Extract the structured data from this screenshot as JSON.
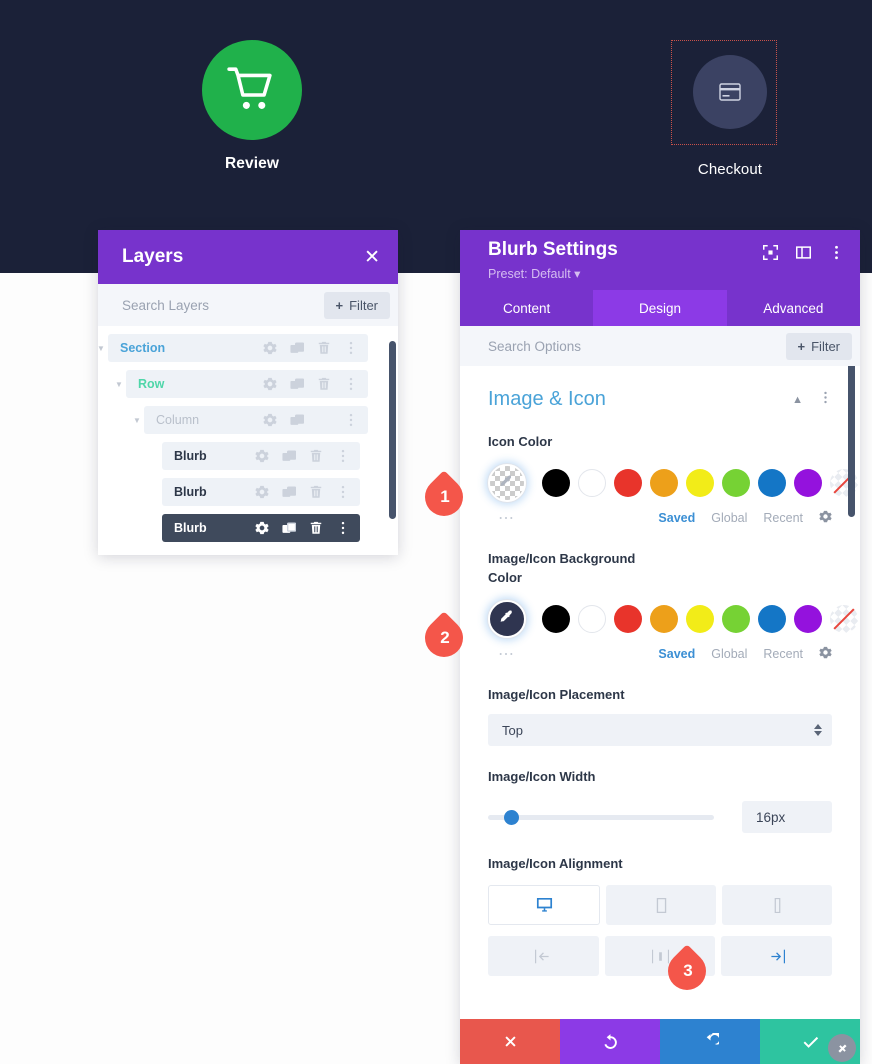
{
  "hero": {
    "items": [
      {
        "label": "Review",
        "icon": "shopping-cart-icon",
        "circle_color": "#20b14b",
        "selected": false
      },
      {
        "label": "Checkout",
        "icon": "credit-card-icon",
        "circle_color": "#3b4263",
        "selected": true
      }
    ],
    "background": "#1b2138",
    "selection_border_color": "#c9524b"
  },
  "layers_panel": {
    "title": "Layers",
    "close_icon": "close-icon",
    "search_placeholder": "Search Layers",
    "filter_label": "Filter",
    "header_color": "#7733cc",
    "rows": [
      {
        "name": "Section",
        "indent": 0,
        "caret": true,
        "selected": false,
        "has_trash": true,
        "type": "section"
      },
      {
        "name": "Row",
        "indent": 1,
        "caret": true,
        "selected": false,
        "has_trash": true,
        "type": "row"
      },
      {
        "name": "Column",
        "indent": 2,
        "caret": true,
        "selected": false,
        "has_trash": false,
        "type": "column"
      },
      {
        "name": "Blurb",
        "indent": 3,
        "caret": false,
        "selected": false,
        "has_trash": true,
        "type": "blurb"
      },
      {
        "name": "Blurb",
        "indent": 3,
        "caret": false,
        "selected": false,
        "has_trash": true,
        "type": "blurb"
      },
      {
        "name": "Blurb",
        "indent": 3,
        "caret": false,
        "selected": true,
        "has_trash": true,
        "type": "blurb"
      }
    ],
    "row_icons": [
      "gear-icon",
      "duplicate-icon",
      "trash-icon",
      "more-vertical-icon"
    ]
  },
  "settings_panel": {
    "title": "Blurb Settings",
    "preset": "Preset: Default",
    "header_icons": [
      "fullscreen-icon",
      "panel-layout-icon",
      "more-vertical-icon"
    ],
    "tabs": [
      {
        "label": "Content",
        "active": false
      },
      {
        "label": "Design",
        "active": true
      },
      {
        "label": "Advanced",
        "active": false
      }
    ],
    "search_placeholder": "Search Options",
    "filter_label": "Filter",
    "section": {
      "title": "Image & Icon",
      "collapse_icon": "chevron-up-icon",
      "menu_icon": "more-vertical-icon"
    },
    "palette": [
      "#000000",
      "#ffffff",
      "#e8342b",
      "#eda01a",
      "#f2ec18",
      "#76d234",
      "#1476c6",
      "#9412dd"
    ],
    "palette_none_label": "none-swatch",
    "color_tabs": [
      {
        "label": "Saved",
        "active": true
      },
      {
        "label": "Global",
        "active": false
      },
      {
        "label": "Recent",
        "active": false
      }
    ],
    "fields": [
      {
        "label": "Icon Color",
        "main_swatch": "transparent-checker",
        "pin": "1"
      },
      {
        "label": "Image/Icon Background Color",
        "main_swatch": "eyedropper-dark",
        "main_swatch_color": "#2f3550",
        "pin": "2"
      }
    ],
    "placement": {
      "label": "Image/Icon Placement",
      "value": "Top"
    },
    "width": {
      "label": "Image/Icon Width",
      "value": "16px",
      "slider_percent": 7
    },
    "alignment": {
      "label": "Image/Icon Alignment",
      "devices": [
        {
          "icon": "desktop-icon",
          "active": true
        },
        {
          "icon": "tablet-icon",
          "active": false
        },
        {
          "icon": "phone-icon",
          "active": false
        }
      ],
      "options": [
        {
          "icon": "align-left-icon",
          "active": false
        },
        {
          "icon": "align-center-icon",
          "active": false
        },
        {
          "icon": "align-right-icon",
          "active": true
        }
      ],
      "pin": "3"
    },
    "actions": [
      {
        "name": "cancel",
        "icon": "close-icon",
        "color": "#e8574d"
      },
      {
        "name": "undo",
        "icon": "undo-icon",
        "color": "#8c3ae6"
      },
      {
        "name": "redo",
        "icon": "redo-icon",
        "color": "#2d82d0"
      },
      {
        "name": "save",
        "icon": "check-icon",
        "color": "#2ec4a0"
      }
    ],
    "resize_grip_icon": "resize-handle-icon"
  }
}
